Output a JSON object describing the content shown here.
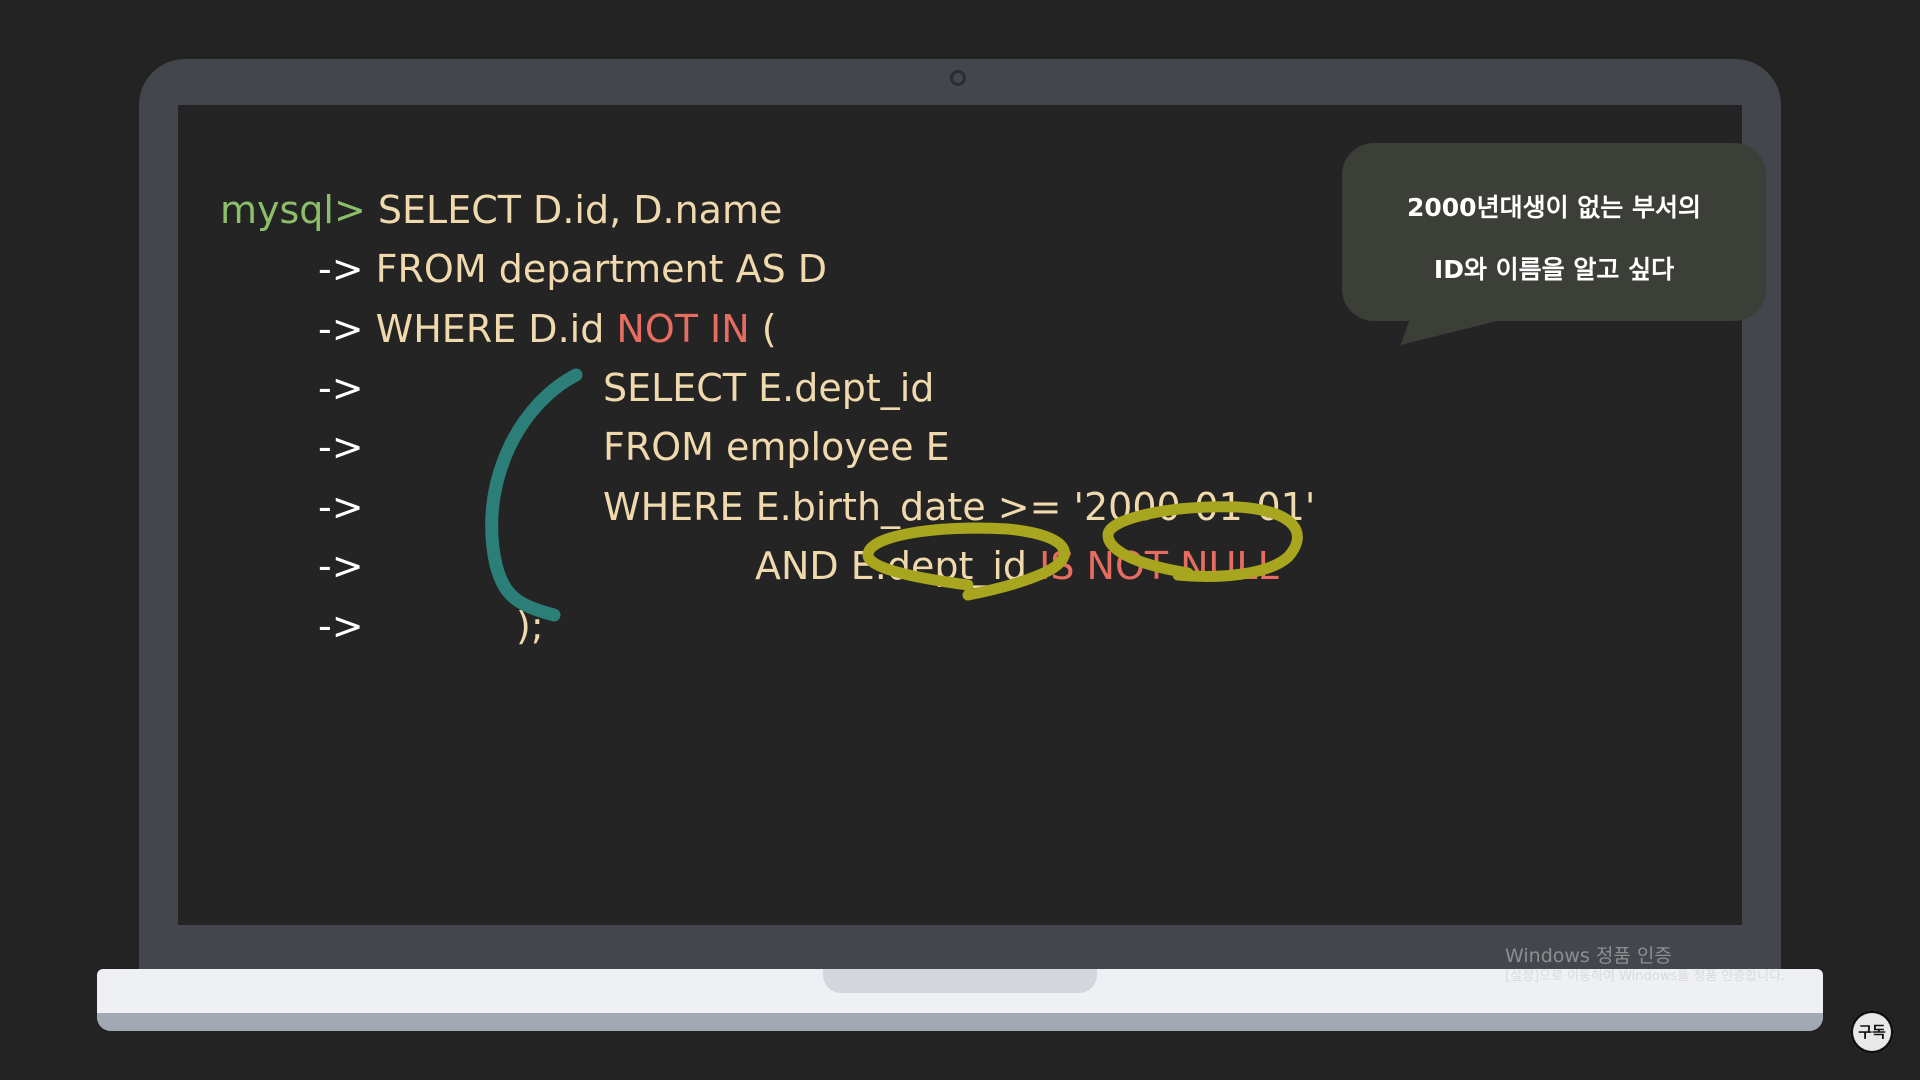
{
  "code": {
    "prompt": "mysql>",
    "continuation": "->",
    "lines": [
      {
        "text": "SELECT D.id, D.name"
      },
      {
        "text": "FROM department AS D"
      },
      {
        "text": "WHERE D.id ",
        "keyword": "NOT IN",
        "after": " ("
      },
      {
        "text": "SELECT E.dept_id"
      },
      {
        "text": "FROM employee E"
      },
      {
        "text": "WHERE E.birth_date >= '2000-01-01'"
      },
      {
        "text": "AND E.dept_id ",
        "keyword": "IS NOT NULL"
      },
      {
        "text": ");"
      }
    ]
  },
  "bubble": {
    "line1": "2000년대생이 없는 부서의",
    "line2": "ID와 이름을 알고 싶다"
  },
  "watermark": {
    "title": "Windows 정품 인증",
    "subtitle": "[설정]으로 이동하여 Windows를 정품 인증합니다."
  },
  "subscribe_button": {
    "label": "구독"
  },
  "colors": {
    "prompt": "#8dbf6a",
    "code_text": "#f0d9ad",
    "keyword": "#e66d60",
    "bracket_annotation": "#2b7f78",
    "circle_annotation": "#a8a51f"
  }
}
